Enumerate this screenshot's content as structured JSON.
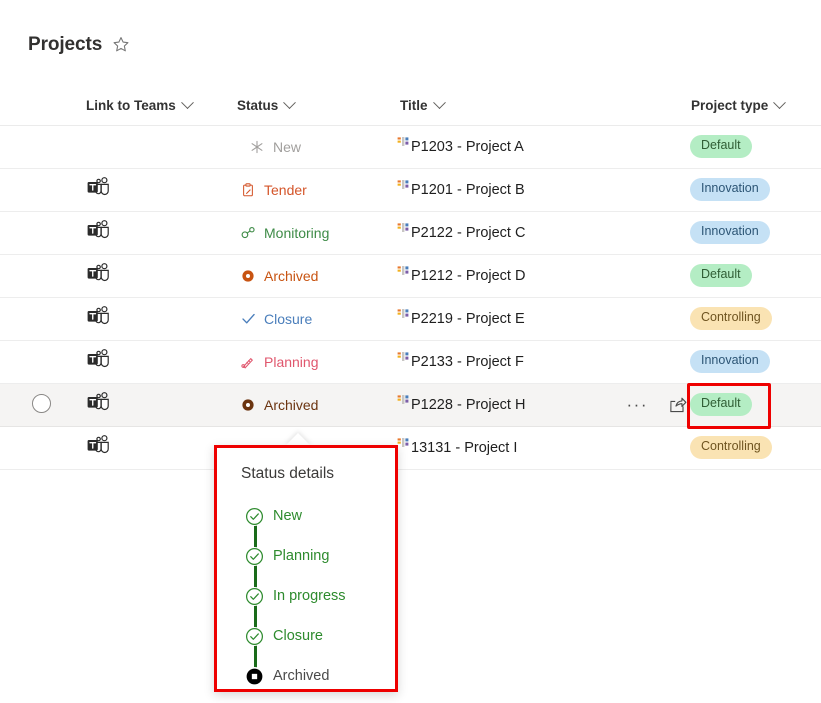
{
  "header": {
    "title": "Projects",
    "favorite_icon": "star-icon"
  },
  "table": {
    "columns": [
      {
        "key": "select",
        "label": ""
      },
      {
        "key": "teams",
        "label": "Link to Teams",
        "sort_icon": "chevron-down-icon"
      },
      {
        "key": "status",
        "label": "Status",
        "sort_icon": "chevron-down-icon"
      },
      {
        "key": "title",
        "label": "Title",
        "sort_icon": "chevron-down-icon"
      },
      {
        "key": "type",
        "label": "Project type",
        "sort_icon": "chevron-down-icon"
      }
    ],
    "rows": [
      {
        "selected": false,
        "selectable": false,
        "teams_link": false,
        "teams_icon": "microsoft-teams-icon",
        "status": "New",
        "status_icon": "sparkle-icon",
        "status_color": "#a19f9d",
        "title": "P1203 - Project A",
        "title_icon": "list-item-icon",
        "type": "Default",
        "type_style": "default",
        "hover": false,
        "show_actions": false
      },
      {
        "selected": false,
        "selectable": false,
        "teams_link": true,
        "teams_icon": "microsoft-teams-icon",
        "status": "Tender",
        "status_icon": "clipboard-icon",
        "status_color": "#d4552a",
        "title": "P1201 - Project B",
        "title_icon": "list-item-icon",
        "type": "Innovation",
        "type_style": "innovation",
        "hover": false,
        "show_actions": false
      },
      {
        "selected": false,
        "selectable": false,
        "teams_link": true,
        "teams_icon": "microsoft-teams-icon",
        "status": "Monitoring",
        "status_icon": "binoculars-icon",
        "status_color": "#3e8b47",
        "title": "P2122 - Project C",
        "title_icon": "list-item-icon",
        "type": "Innovation",
        "type_style": "innovation",
        "hover": false,
        "show_actions": false
      },
      {
        "selected": false,
        "selectable": false,
        "teams_link": true,
        "teams_icon": "microsoft-teams-icon",
        "status": "Archived",
        "status_icon": "filled-circle-icon",
        "status_color": "#c85412",
        "title": "P1212 - Project D",
        "title_icon": "list-item-icon",
        "type": "Default",
        "type_style": "default",
        "hover": false,
        "show_actions": false
      },
      {
        "selected": false,
        "selectable": false,
        "teams_link": true,
        "teams_icon": "microsoft-teams-icon",
        "status": "Closure",
        "status_icon": "checkmark-icon",
        "status_color": "#4a7ebb",
        "title": "P2219 - Project E",
        "title_icon": "list-item-icon",
        "type": "Controlling",
        "type_style": "controlling",
        "hover": false,
        "show_actions": false
      },
      {
        "selected": false,
        "selectable": false,
        "teams_link": true,
        "teams_icon": "microsoft-teams-icon",
        "status": "Planning",
        "status_icon": "pencil-icon",
        "status_color": "#e0566d",
        "title": "P2133 - Project F",
        "title_icon": "list-item-icon",
        "type": "Innovation",
        "type_style": "innovation",
        "hover": false,
        "show_actions": false
      },
      {
        "selected": false,
        "selectable": true,
        "teams_link": true,
        "teams_icon": "microsoft-teams-icon",
        "status": "Archived",
        "status_icon": "filled-circle-icon",
        "status_color": "#6b3410",
        "title": "P1228 - Project H",
        "title_icon": "list-item-icon",
        "type": "Default",
        "type_style": "default",
        "hover": true,
        "show_actions": true,
        "more_label": "···",
        "share_icon": "share-icon"
      },
      {
        "selected": false,
        "selectable": false,
        "teams_link": true,
        "teams_icon": "microsoft-teams-icon",
        "status": "",
        "status_icon": "",
        "status_color": "#c85412",
        "title": "13131 - Project I",
        "title_icon": "list-item-icon",
        "type": "Controlling",
        "type_style": "controlling",
        "hover": false,
        "show_actions": false
      }
    ]
  },
  "callout": {
    "title": "Status details",
    "steps": [
      {
        "label": "New",
        "state": "done",
        "icon": "check-circle-icon"
      },
      {
        "label": "Planning",
        "state": "done",
        "icon": "check-circle-icon"
      },
      {
        "label": "In progress",
        "state": "done",
        "icon": "check-circle-icon"
      },
      {
        "label": "Closure",
        "state": "done",
        "icon": "check-circle-icon"
      },
      {
        "label": "Archived",
        "state": "current",
        "icon": "filled-stop-circle-icon"
      }
    ]
  },
  "annotations": {
    "pill_highlight": {
      "target": "Default",
      "color": "#ee0000"
    },
    "callout_highlight": {
      "target": "Status details",
      "color": "#ee0000"
    }
  },
  "colors": {
    "accent_red": "#ee0000",
    "pill_default_bg": "#b4edc4",
    "pill_innovation_bg": "#c5e1f5",
    "pill_controlling_bg": "#fae3b3",
    "step_green": "#2e8b2e",
    "row_hover_bg": "#f5f4f3"
  }
}
